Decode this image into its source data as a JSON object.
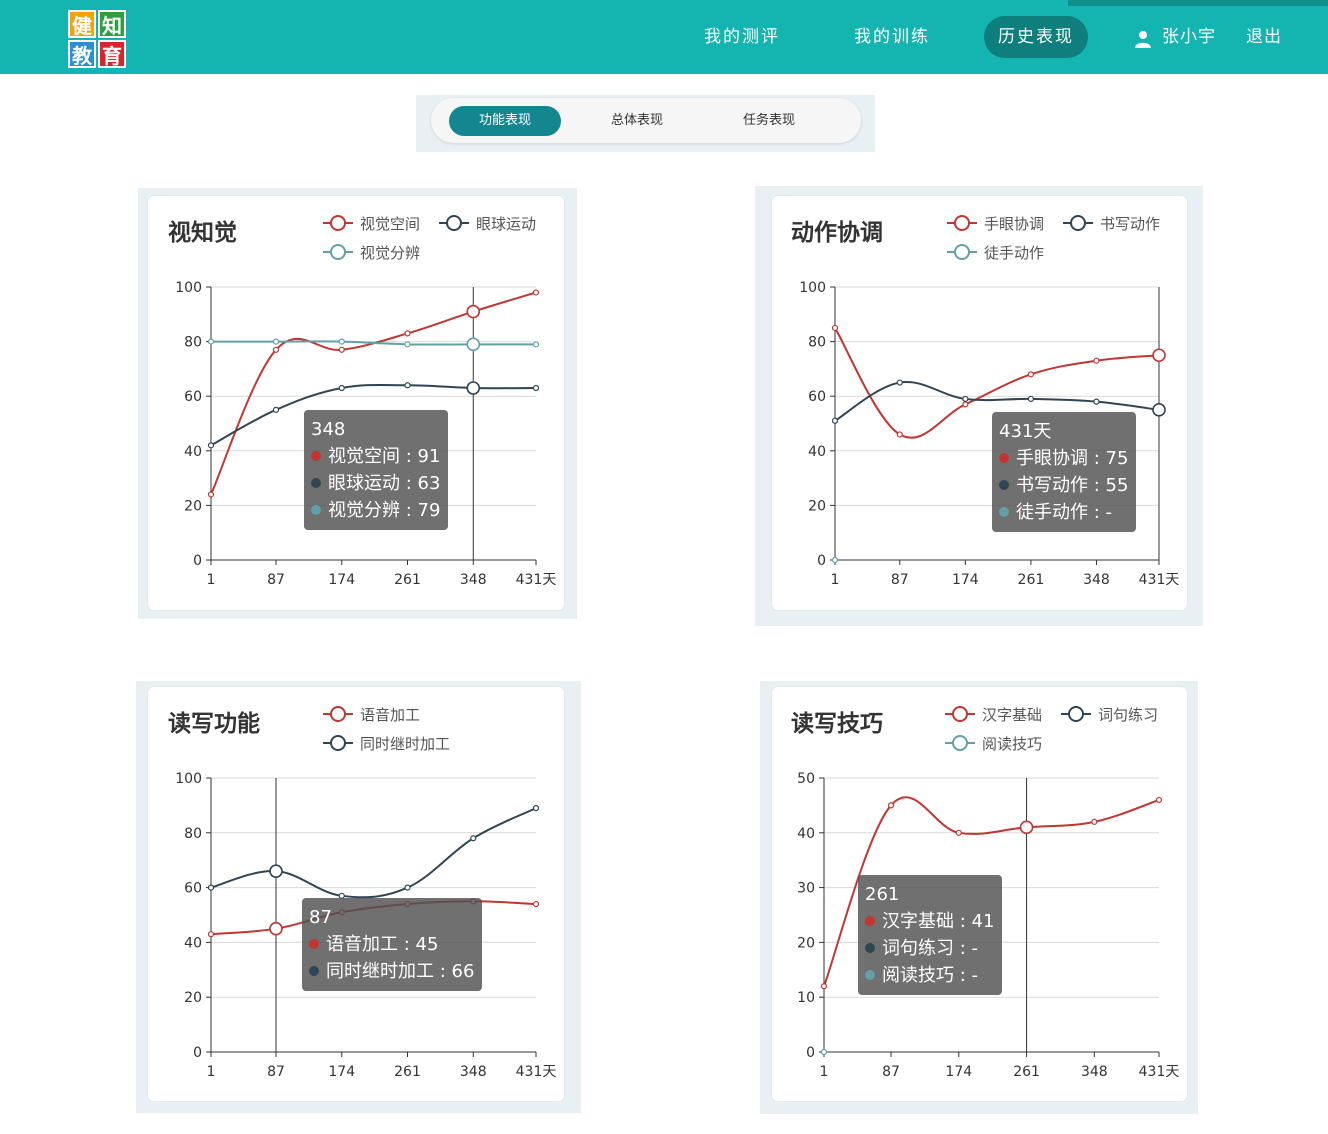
{
  "header": {
    "logo": [
      "健",
      "知",
      "教",
      "育"
    ],
    "nav": [
      {
        "label": "我的测评"
      },
      {
        "label": "我的训练"
      },
      {
        "label": "历史表现"
      }
    ],
    "user_name": "张小宇",
    "logout_label": "退出",
    "colors": {
      "bar": "#14b4b0",
      "active": "#0e7f7c"
    }
  },
  "tabs": {
    "items": [
      {
        "label": "功能表现"
      },
      {
        "label": "总体表现"
      },
      {
        "label": "任务表现"
      }
    ],
    "active_index": 0
  },
  "chart_data": [
    {
      "type": "line",
      "title": "视知觉",
      "x": [
        1,
        87,
        174,
        261,
        348,
        431
      ],
      "xunit": "天",
      "ylim": [
        0,
        100
      ],
      "yticks": [
        0,
        20,
        40,
        60,
        80,
        100
      ],
      "grid": true,
      "legend": "top-right",
      "series": [
        {
          "name": "视觉空间",
          "color": "#c23531",
          "values": [
            24,
            77,
            77,
            83,
            91,
            98
          ]
        },
        {
          "name": "眼球运动",
          "color": "#2f4554",
          "values": [
            42,
            55,
            63,
            64,
            63,
            63
          ]
        },
        {
          "name": "视觉分辨",
          "color": "#61a0a8",
          "values": [
            80,
            80,
            80,
            79,
            79,
            79
          ]
        }
      ],
      "tooltip": {
        "x_label": "348",
        "x_index": 4,
        "rows": [
          "视觉空间 : 91",
          "眼球运动 : 63",
          "视觉分辨 : 79"
        ]
      }
    },
    {
      "type": "line",
      "title": "动作协调",
      "x": [
        1,
        87,
        174,
        261,
        348,
        431
      ],
      "xunit": "天",
      "ylim": [
        0,
        100
      ],
      "yticks": [
        0,
        20,
        40,
        60,
        80,
        100
      ],
      "grid": true,
      "legend": "top-right",
      "series": [
        {
          "name": "手眼协调",
          "color": "#c23531",
          "values": [
            85,
            46,
            57,
            68,
            73,
            75
          ]
        },
        {
          "name": "书写动作",
          "color": "#2f4554",
          "values": [
            51,
            65,
            59,
            59,
            58,
            55
          ]
        },
        {
          "name": "徒手动作",
          "color": "#61a0a8",
          "values": [
            0,
            null,
            null,
            null,
            null,
            null
          ]
        }
      ],
      "tooltip": {
        "x_label": "431天",
        "x_index": 5,
        "rows": [
          "手眼协调 : 75",
          "书写动作 : 55",
          "徒手动作 : -"
        ]
      }
    },
    {
      "type": "line",
      "title": "读写功能",
      "x": [
        1,
        87,
        174,
        261,
        348,
        431
      ],
      "xunit": "天",
      "ylim": [
        0,
        100
      ],
      "yticks": [
        0,
        20,
        40,
        60,
        80,
        100
      ],
      "grid": true,
      "legend": "top-right",
      "series": [
        {
          "name": "语音加工",
          "color": "#c23531",
          "values": [
            43,
            45,
            51,
            54,
            55,
            54
          ]
        },
        {
          "name": "同时继时加工",
          "color": "#2f4554",
          "values": [
            60,
            66,
            57,
            60,
            78,
            89
          ]
        }
      ],
      "tooltip": {
        "x_label": "87",
        "x_index": 1,
        "rows": [
          "语音加工 : 45",
          "同时继时加工 : 66"
        ]
      }
    },
    {
      "type": "line",
      "title": "读写技巧",
      "x": [
        1,
        87,
        174,
        261,
        348,
        431
      ],
      "xunit": "天",
      "ylim": [
        0,
        50
      ],
      "yticks": [
        0,
        10,
        20,
        30,
        40,
        50
      ],
      "grid": true,
      "legend": "top-right",
      "series": [
        {
          "name": "汉字基础",
          "color": "#c23531",
          "values": [
            12,
            45,
            40,
            41,
            42,
            46
          ]
        },
        {
          "name": "词句练习",
          "color": "#2f4554",
          "values": [
            null,
            null,
            null,
            null,
            null,
            null
          ]
        },
        {
          "name": "阅读技巧",
          "color": "#61a0a8",
          "values": [
            0,
            null,
            null,
            null,
            null,
            null
          ]
        }
      ],
      "tooltip": {
        "x_label": "261",
        "x_index": 3,
        "rows": [
          "汉字基础 : 41",
          "词句练习 : -",
          "阅读技巧 : -"
        ]
      }
    }
  ]
}
